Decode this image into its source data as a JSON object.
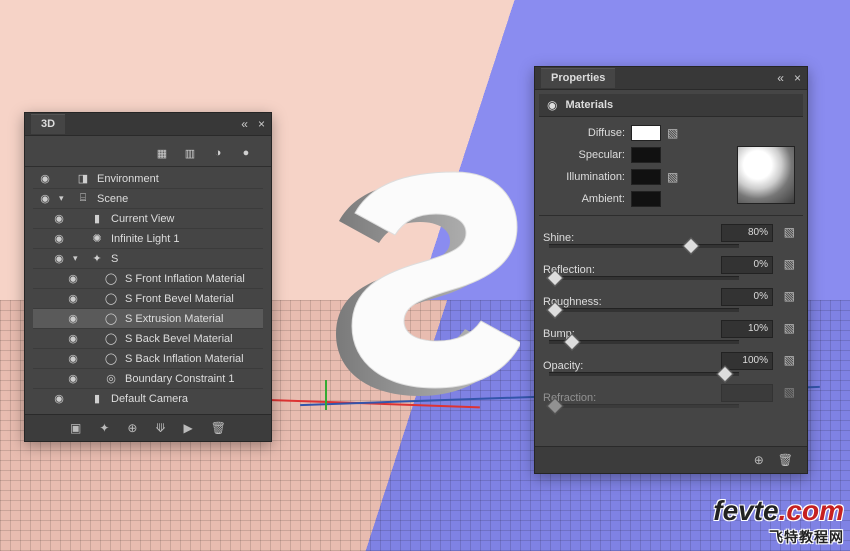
{
  "panels": {
    "threeD": {
      "title": "3D",
      "tree": [
        {
          "eye": true,
          "twist": "",
          "icon": "env",
          "label": "Environment",
          "indent": 0
        },
        {
          "eye": true,
          "twist": "▾",
          "icon": "scene",
          "label": "Scene",
          "indent": 0
        },
        {
          "eye": true,
          "twist": "",
          "icon": "camera",
          "label": "Current View",
          "indent": 1
        },
        {
          "eye": true,
          "twist": "",
          "icon": "light",
          "label": "Infinite Light 1",
          "indent": 1
        },
        {
          "eye": true,
          "twist": "▾",
          "icon": "mesh",
          "label": "S",
          "indent": 1
        },
        {
          "eye": true,
          "twist": "",
          "icon": "material",
          "label": "S Front Inflation Material",
          "indent": 2
        },
        {
          "eye": true,
          "twist": "",
          "icon": "material",
          "label": "S Front Bevel Material",
          "indent": 2
        },
        {
          "eye": true,
          "twist": "",
          "icon": "material",
          "label": "S Extrusion Material",
          "indent": 2,
          "selected": true
        },
        {
          "eye": true,
          "twist": "",
          "icon": "material",
          "label": "S Back Bevel Material",
          "indent": 2
        },
        {
          "eye": true,
          "twist": "",
          "icon": "material",
          "label": "S Back Inflation Material",
          "indent": 2
        },
        {
          "eye": true,
          "twist": "",
          "icon": "constraint",
          "label": "Boundary Constraint 1",
          "indent": 2
        },
        {
          "eye": true,
          "twist": "",
          "icon": "camera",
          "label": "Default Camera",
          "indent": 1
        }
      ]
    },
    "properties": {
      "title": "Properties",
      "section": "Materials",
      "swatches": [
        {
          "label": "Diffuse:",
          "color": "white",
          "folder": true
        },
        {
          "label": "Specular:",
          "color": "black",
          "folder": false
        },
        {
          "label": "Illumination:",
          "color": "black",
          "folder": true
        },
        {
          "label": "Ambient:",
          "color": "black",
          "folder": false
        }
      ],
      "sliders": [
        {
          "label": "Shine:",
          "value": "80%",
          "pos": 0.8
        },
        {
          "label": "Reflection:",
          "value": "0%",
          "pos": 0.0
        },
        {
          "label": "Roughness:",
          "value": "0%",
          "pos": 0.0
        },
        {
          "label": "Bump:",
          "value": "10%",
          "pos": 0.1
        },
        {
          "label": "Opacity:",
          "value": "100%",
          "pos": 1.0
        },
        {
          "label": "Refraction:",
          "value": "",
          "pos": 0.0,
          "cut": true
        }
      ]
    }
  },
  "watermark": {
    "brand": "fevte",
    "tld": ".com",
    "sub": "飞特教程网"
  }
}
